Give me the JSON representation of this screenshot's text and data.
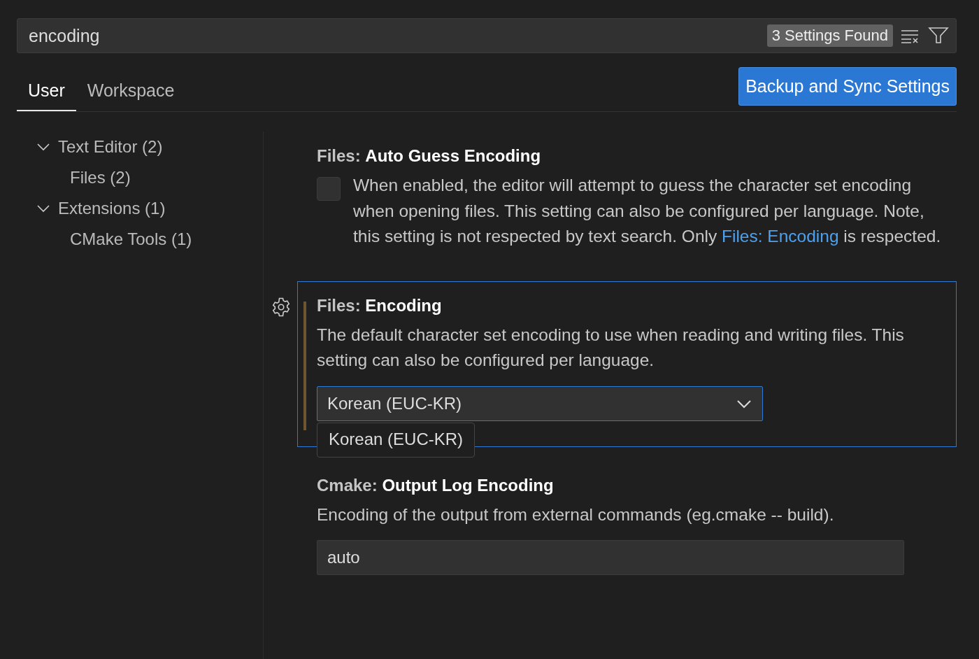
{
  "search": {
    "value": "encoding",
    "results_badge": "3 Settings Found"
  },
  "tabs": [
    {
      "label": "User",
      "selected": true
    },
    {
      "label": "Workspace",
      "selected": false
    }
  ],
  "sync_button": "Backup and Sync Settings",
  "tree": [
    {
      "label": "Text Editor (2)",
      "expanded": true,
      "children": [
        {
          "label": "Files (2)"
        }
      ]
    },
    {
      "label": "Extensions (1)",
      "expanded": true,
      "children": [
        {
          "label": "CMake Tools (1)"
        }
      ]
    }
  ],
  "settings": [
    {
      "kind": "checkbox",
      "category": "Files: ",
      "name": "Auto Guess Encoding",
      "focused": false,
      "checked": false,
      "description": [
        {
          "kind": "text",
          "text": "When enabled, the editor will attempt to guess the character set encoding when opening files. This setting can also be configured per language. Note, this setting is not respected by text search. Only "
        },
        {
          "kind": "link",
          "text": "Files: Encoding"
        },
        {
          "kind": "text",
          "text": " is respected."
        }
      ]
    },
    {
      "kind": "dropdown",
      "category": "Files: ",
      "name": "Encoding",
      "focused": true,
      "description": [
        {
          "kind": "text",
          "text": "The default character set encoding to use when reading and writing files. This setting can also be configured per language."
        }
      ],
      "value": "Korean (EUC-KR)",
      "expanded": true,
      "options": [
        "Korean (EUC-KR)"
      ]
    },
    {
      "kind": "text",
      "category": "Cmake: ",
      "name": "Output Log Encoding",
      "focused": false,
      "description": [
        {
          "kind": "text",
          "text": "Encoding of the output from external commands (eg.cmake -- build)."
        }
      ],
      "value": "auto"
    }
  ]
}
